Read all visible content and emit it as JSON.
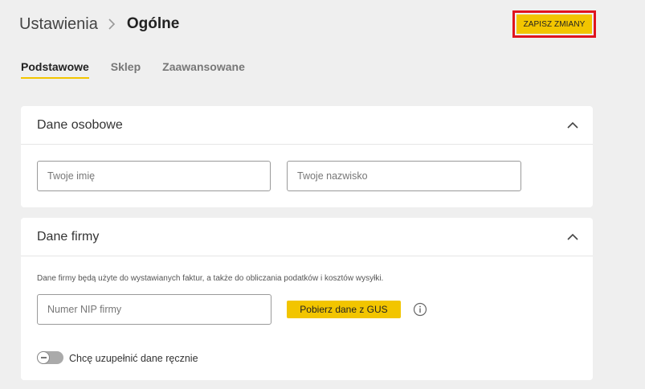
{
  "header": {
    "breadcrumb_root": "Ustawienia",
    "breadcrumb_current": "Ogólne",
    "save_label": "ZAPISZ ZMIANY"
  },
  "tabs": [
    {
      "label": "Podstawowe",
      "active": true
    },
    {
      "label": "Sklep",
      "active": false
    },
    {
      "label": "Zaawansowane",
      "active": false
    }
  ],
  "personal": {
    "title": "Dane osobowe",
    "first_name_placeholder": "Twoje imię",
    "last_name_placeholder": "Twoje nazwisko"
  },
  "company": {
    "title": "Dane firmy",
    "description": "Dane firmy będą użyte do wystawianych faktur, a także do obliczania podatków i kosztów wysyłki.",
    "nip_placeholder": "Numer NIP firmy",
    "gus_button": "Pobierz dane z GUS",
    "manual_toggle_label": "Chcę uzupełnić dane ręcznie",
    "manual_toggle_on": false
  },
  "icons": {
    "breadcrumb_separator": "chevron-right-icon",
    "collapse": "chevron-up-icon",
    "info": "info-icon"
  },
  "colors": {
    "accent": "#f2c500",
    "highlight_border": "#e0141e",
    "background": "#efefef"
  }
}
